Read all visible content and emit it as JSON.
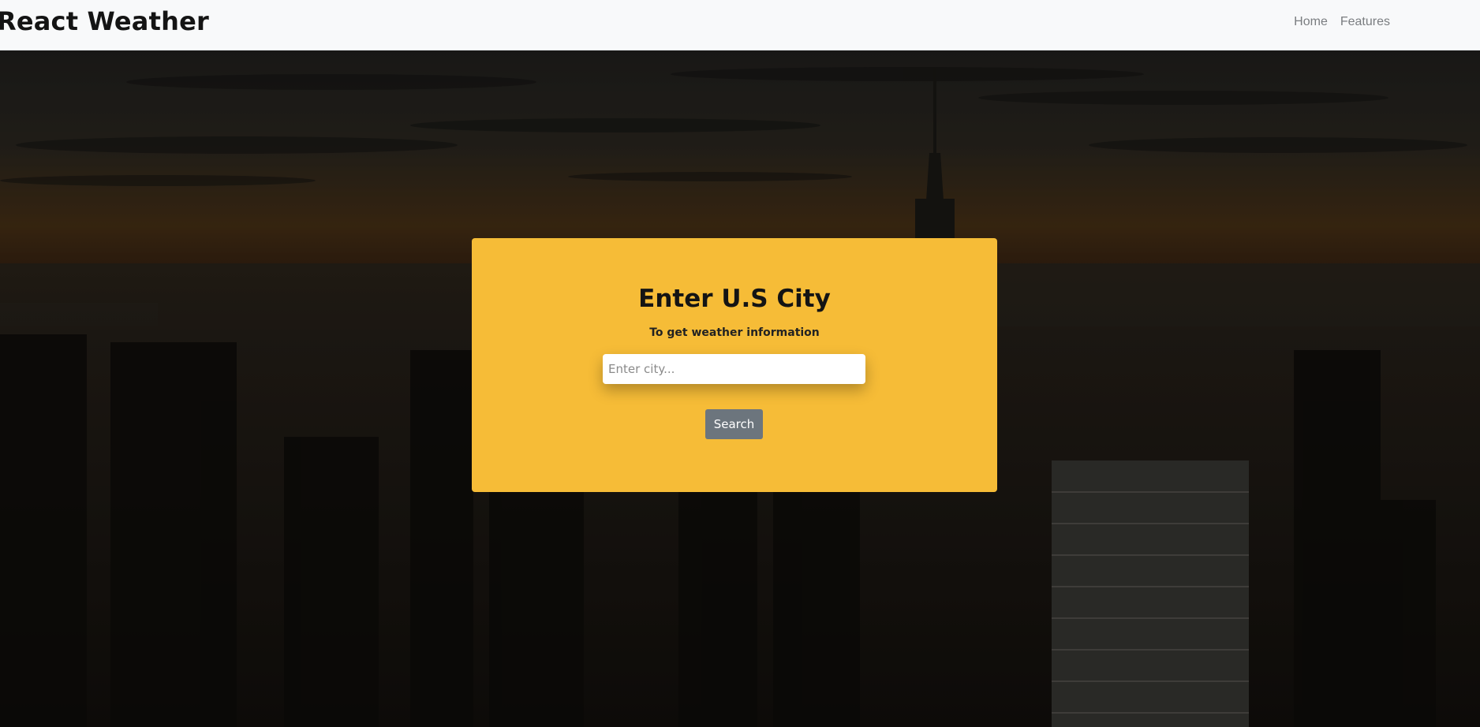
{
  "navbar": {
    "brand": "React Weather",
    "links": [
      {
        "label": "Home"
      },
      {
        "label": "Features"
      }
    ]
  },
  "search_card": {
    "title": "Enter U.S City",
    "subtitle": "To get weather information",
    "input": {
      "placeholder": "Enter city...",
      "value": ""
    },
    "button_label": "Search"
  },
  "colors": {
    "card_bg": "#f6bc37",
    "button_bg": "#6c757d",
    "navbar_bg": "#f8f9fa"
  }
}
